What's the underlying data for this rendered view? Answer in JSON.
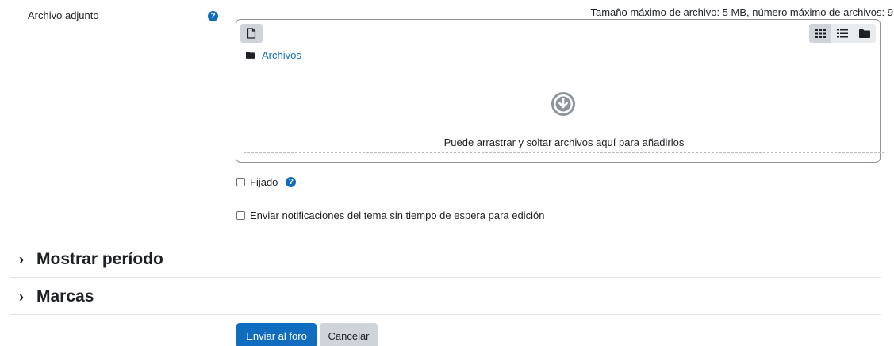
{
  "attachment": {
    "label": "Archivo adjunto",
    "limits": "Tamaño máximo de archivo: 5 MB, número máximo de archivos: 9"
  },
  "filemanager": {
    "path_label": "Archivos",
    "drop_text": "Puede arrastrar y soltar archivos aquí para añadirlos",
    "views": [
      "grid-icon",
      "list-icon",
      "folder-icon"
    ]
  },
  "options": {
    "pinned_label": "Fijado",
    "notify_label": "Enviar notificaciones del tema sin tiempo de espera para edición"
  },
  "sections": {
    "display_period": "Mostrar período",
    "tags": "Marcas"
  },
  "buttons": {
    "submit": "Enviar al foro",
    "cancel": "Cancelar"
  },
  "colors": {
    "primary": "#0f6cbf",
    "secondary": "#ced4da"
  }
}
